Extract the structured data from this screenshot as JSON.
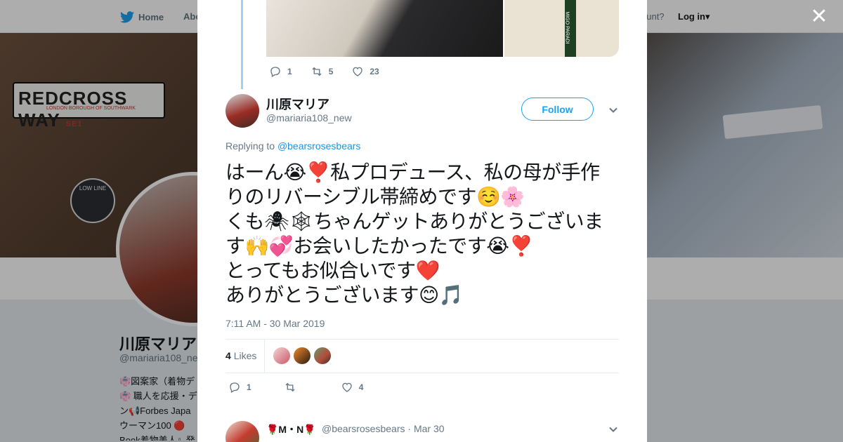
{
  "nav": {
    "home": "Home",
    "about": "Abo",
    "account_prompt": "ccount?",
    "login": "Log in"
  },
  "banner": {
    "sign_main": "REDCROSS WAY",
    "sign_code": "SE1",
    "sign_sub": "LONDON BOROUGH OF SOUTHWARK",
    "plaque": "LOW LINE"
  },
  "profile": {
    "name": "川原マリア",
    "handle": "@mariaria108_ne",
    "bio": "👘図案家（着物デ\n👘 職人を応援・デ\nン📢Forbes Japa\nウーマン100 🔴\nBook着物美人』発"
  },
  "prev_tweet": {
    "image_right_label": "MIGO PARADI",
    "replies": "1",
    "retweets": "5",
    "likes": "23"
  },
  "tweet": {
    "name": "川原マリア",
    "handle": "@mariaria108_new",
    "follow_label": "Follow",
    "replying_prefix": "Replying to ",
    "replying_to": "@bearsrosesbears",
    "text": "はーん😭❣️私プロデュース、私の母が手作りのリバーシブル帯締めです☺️🌸\nくも🕷🕸ちゃんゲットありがとうございます🙌💞お会いしたかったです😭❣️\nとってもお似合いです❤️\nありがとうございます😊🎵",
    "timestamp": "7:11 AM - 30 Mar 2019",
    "likes_count": "4",
    "likes_label": "Likes",
    "replies": "1",
    "retweets": "",
    "likes": "4"
  },
  "reply": {
    "name": "🌹M・N🌹",
    "handle": "@bearsrosesbears",
    "date": "Mar 30"
  },
  "colors": {
    "accent": "#1da1f2",
    "text": "#14171a",
    "muted": "#657786"
  }
}
